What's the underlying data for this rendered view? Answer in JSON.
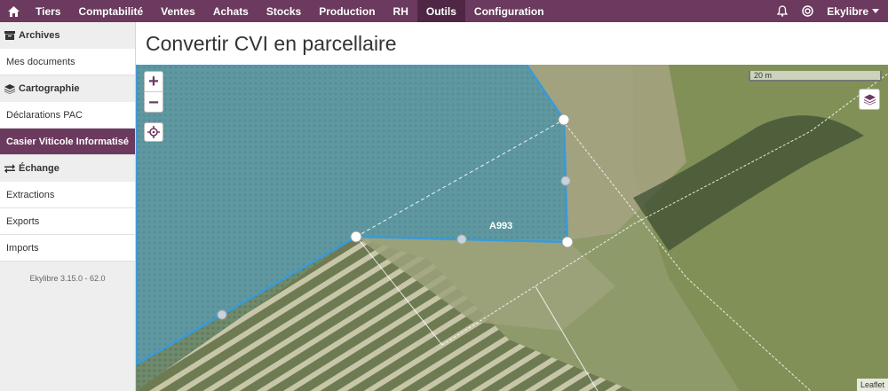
{
  "topbar": {
    "menu": [
      "Tiers",
      "Comptabilité",
      "Ventes",
      "Achats",
      "Stocks",
      "Production",
      "RH",
      "Outils",
      "Configuration"
    ],
    "active_menu": "Outils",
    "user": "Ekylibre"
  },
  "sidebar": {
    "sections": [
      {
        "title": "Archives",
        "icon": "archive-icon",
        "items": [
          "Mes documents"
        ]
      },
      {
        "title": "Cartographie",
        "icon": "layers-icon",
        "items": [
          "Déclarations PAC",
          "Casier Viticole Informatisé"
        ]
      },
      {
        "title": "Échange",
        "icon": "exchange-icon",
        "items": [
          "Extractions",
          "Exports",
          "Imports"
        ]
      }
    ],
    "active_item": "Casier Viticole Informatisé",
    "version": "Ekylibre 3.15.0 - 62.0"
  },
  "page": {
    "title": "Convertir CVI en parcellaire"
  },
  "map": {
    "zoom_in": "+",
    "zoom_out": "−",
    "scale_label": "20 m",
    "parcel_label": "A993",
    "attribution": "Leaflet",
    "polygon_color": "#3a9ad9"
  }
}
